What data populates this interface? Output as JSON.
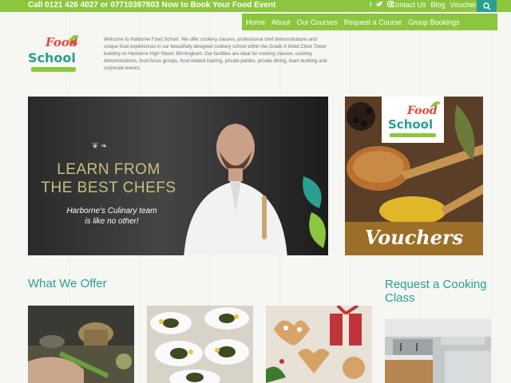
{
  "topbar": {
    "phone_text": "Call 0121 426 4027 or 07710397803 Now to Book Your Food Event",
    "social_icons": [
      "facebook-icon",
      "twitter-icon",
      "instagram-icon"
    ],
    "links": [
      "Contact Us",
      "Blog",
      "Vouchers"
    ]
  },
  "nav": {
    "items": [
      "Home",
      "About",
      "Our Courses",
      "Request a Course",
      "Group Bookings"
    ]
  },
  "logo": {
    "line1": "Food",
    "line2": "School"
  },
  "intro_text": "Welcome to Harborne Food School. We offer cookery classes, professional chef demonstrations and unique food experiences in our beautifully designed cookery school within the Grade II listed Clock Tower building on Harborne High Street, Birmingham. Our facilities are ideal for cooking classes, cooking demonstrations, food focus groups, food related training, private parties, private dining, team building and corporate events.",
  "hero": {
    "headline_line1": "LEARN FROM",
    "headline_line2": "THE BEST CHEFS",
    "subline_line1": "Harborne's Culinary team",
    "subline_line2": "is like no other!"
  },
  "voucher": {
    "label": "Vouchers"
  },
  "sections": {
    "offer_title": "What We Offer",
    "request_title_line1": "Request a Cooking",
    "request_title_line2": "Class"
  },
  "colors": {
    "accent_green": "#8cc63f",
    "teal": "#2a9f92"
  }
}
